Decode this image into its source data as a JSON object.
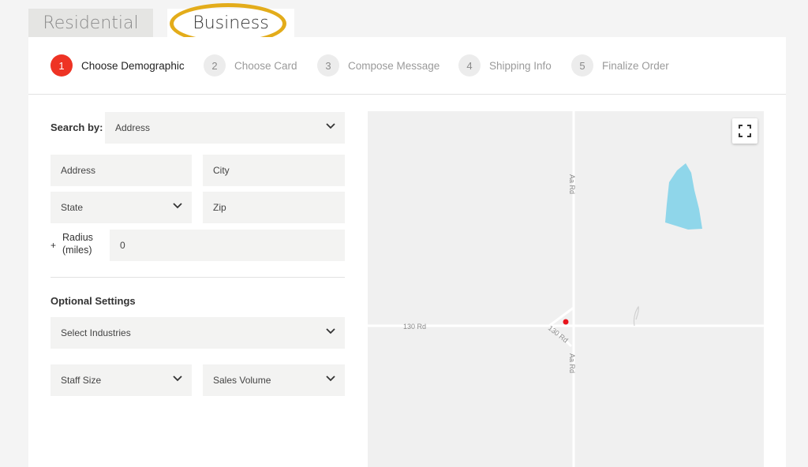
{
  "tabs": {
    "residential": "Residential",
    "business": "Business"
  },
  "stepper": {
    "steps": [
      {
        "num": "1",
        "label": "Choose Demographic"
      },
      {
        "num": "2",
        "label": "Choose Card"
      },
      {
        "num": "3",
        "label": "Compose Message"
      },
      {
        "num": "4",
        "label": "Shipping Info"
      },
      {
        "num": "5",
        "label": "Finalize Order"
      }
    ]
  },
  "form": {
    "search_by_label": "Search by:",
    "search_by_value": "Address",
    "address_placeholder": "Address",
    "city_placeholder": "City",
    "state_value": "State",
    "zip_placeholder": "Zip",
    "radius_plus": "+",
    "radius_label": "Radius (miles)",
    "radius_value": "0",
    "optional_settings_label": "Optional Settings",
    "industries_value": "Select Industries",
    "staff_size_value": "Staff Size",
    "sales_volume_value": "Sales Volume"
  },
  "map": {
    "road_labels": {
      "aa_rd_north": "Aa Rd",
      "aa_rd_south": "Aa Rd",
      "rd_130_west": "130 Rd",
      "rd_130_diag": "130 Rd"
    },
    "marker_color": "#e8141c",
    "water_color": "#8fd6ea",
    "road_color": "#ffffff"
  },
  "colors": {
    "accent": "#ee3324",
    "highlight_ring": "#e3ac1a"
  }
}
